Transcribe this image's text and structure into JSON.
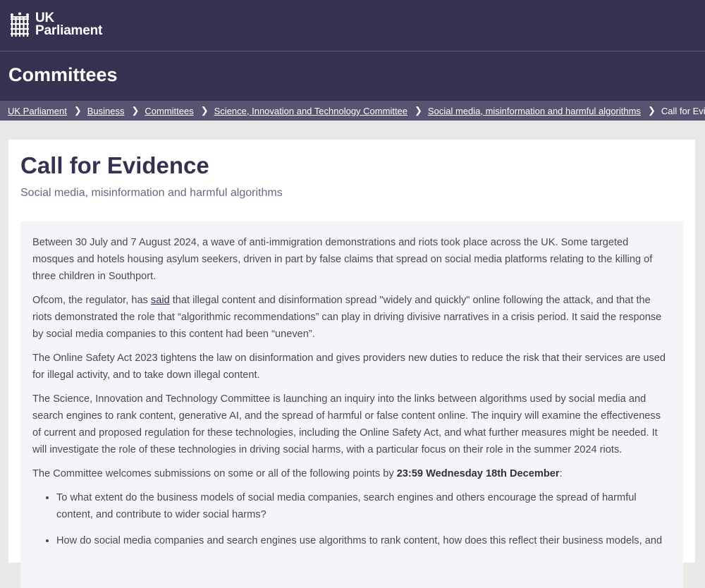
{
  "header": {
    "logo_line1": "UK",
    "logo_line2": "Parliament",
    "section_title": "Committees"
  },
  "breadcrumb": [
    "UK Parliament",
    "Business",
    "Committees",
    "Science, Innovation and Technology Committee",
    "Social media, misinformation and harmful algorithms"
  ],
  "breadcrumb_current": "Call for Evide...",
  "page": {
    "title": "Call for Evidence",
    "subtitle": "Social media, misinformation and harmful algorithms"
  },
  "body": {
    "p1": "Between 30 July and 7 August 2024, a wave of anti-immigration demonstrations and riots took place across the UK. Some targeted mosques and hotels housing asylum seekers, driven in part by false claims that spread on social media platforms relating to the killing of three children in Southport.",
    "p2_before": "Ofcom, the regulator, has ",
    "p2_link": "said",
    "p2_after": " that illegal content and disinformation spread \"widely and quickly\" online following the attack, and that the riots demonstrated the role that “algorithmic recommendations” can play in driving divisive narratives in a crisis period. It said the response by social media companies to this content had been “uneven”.",
    "p3": "The Online Safety Act 2023 tightens the law on disinformation and gives providers new duties to reduce the risk that their services are used for illegal activity, and to take down illegal content.",
    "p4": "The Science, Innovation and Technology Committee is launching an inquiry into the links between algorithms used by social media and search engines to rank content, generative AI, and the spread of harmful or false content online. The inquiry will examine the effectiveness of current and proposed regulation for these technologies, including the Online Safety Act, and what further measures might be needed. It will investigate the role of these technologies in driving social harms, with a particular focus on their role in the summer 2024 riots.",
    "p5_before": "The Committee welcomes submissions on some or all of the following points by ",
    "p5_bold": "23:59 Wednesday 18th December",
    "p5_after": ":",
    "bullets": [
      "To what extent do the business models of social media companies, search engines and others encourage the spread of harmful content, and contribute to wider social harms?",
      "How do social media companies and search engines use algorithms to rank content, how does this reflect their business models, and"
    ]
  }
}
